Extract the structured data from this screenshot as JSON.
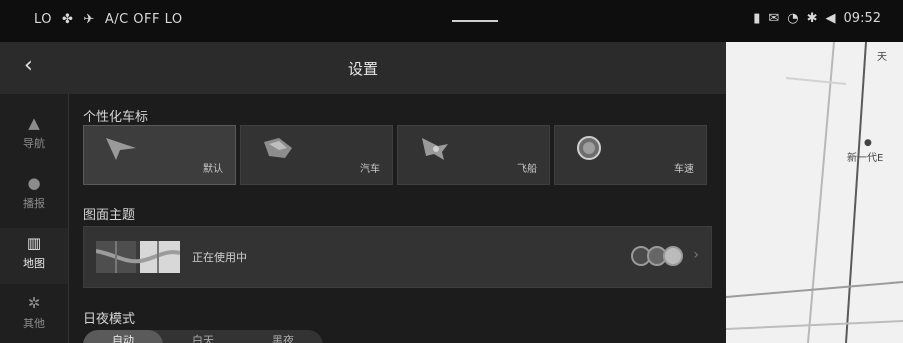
{
  "statusbar": {
    "lo_left": "LO",
    "fan_icon": "fan-icon",
    "ac_icon": "ac-icon",
    "ac_status": "A/C OFF LO",
    "time": "09:52",
    "right_icons": [
      "phone-battery-icon",
      "message-icon",
      "wifi-icon",
      "bluetooth-icon",
      "volume-icon"
    ]
  },
  "header": {
    "back_icon": "back-chevron-icon",
    "title": "设置"
  },
  "nav": {
    "items": [
      {
        "label": "导航",
        "icon": "navigation-arrow-icon"
      },
      {
        "label": "播报",
        "icon": "microphone-icon"
      },
      {
        "label": "地图",
        "icon": "map-icon"
      },
      {
        "label": "其他",
        "icon": "gear-icon"
      }
    ],
    "active_index": 2
  },
  "sections": {
    "marker_title": "个性化车标",
    "markers": [
      {
        "label": "默认",
        "icon": "arrow-icon"
      },
      {
        "label": "汽车",
        "icon": "car-icon"
      },
      {
        "label": "飞船",
        "icon": "spaceship-icon"
      },
      {
        "label": "车速",
        "icon": "speedometer-icon"
      }
    ],
    "theme_title": "图面主题",
    "theme_status": "正在使用中",
    "daynight_title": "日夜模式",
    "daynight_options": [
      "自动",
      "白天",
      "黑夜"
    ]
  },
  "map": {
    "labels": [
      "天",
      "新一代E"
    ]
  },
  "colors": {
    "statusbar": "#0e0e0e",
    "header": "#2b2b2b",
    "panel": "#1c1c1c",
    "card": "#333333",
    "map": "#f1f1f1"
  }
}
